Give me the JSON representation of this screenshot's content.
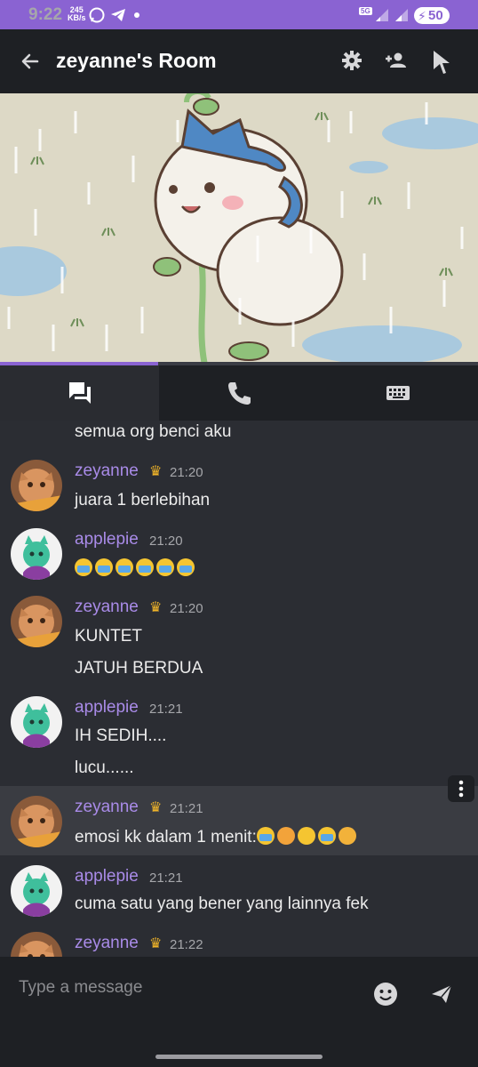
{
  "status": {
    "time": "9:22",
    "speed_value": "245",
    "speed_unit": "KB/s",
    "network": "5G",
    "battery": "50"
  },
  "appbar": {
    "title": "zeyanne's Room"
  },
  "video": {
    "progress_fraction": 0.33
  },
  "tabs": [
    {
      "name": "chat"
    },
    {
      "name": "voice"
    },
    {
      "name": "keyboard"
    }
  ],
  "messages": {
    "m0": {
      "text": "semua org benci aku"
    },
    "m1": {
      "author": "zeyanne",
      "time": "21:20",
      "lines": [
        "juara 1 berlebihan"
      ]
    },
    "m2": {
      "author": "applepie",
      "time": "21:20"
    },
    "m3": {
      "author": "zeyanne",
      "time": "21:20",
      "lines": [
        "KUNTET",
        "JATUH BERDUA"
      ]
    },
    "m4": {
      "author": "applepie",
      "time": "21:21",
      "lines": [
        "IH SEDIH....",
        "lucu......"
      ]
    },
    "m5": {
      "author": "zeyanne",
      "time": "21:21",
      "text": "emosi kk dalam 1 menit:"
    },
    "m6": {
      "author": "applepie",
      "time": "21:21",
      "lines": [
        "cuma satu yang bener yang lainnya fek"
      ]
    },
    "m7": {
      "author": "zeyanne",
      "time": "21:22"
    }
  },
  "composer": {
    "placeholder": "Type a message"
  },
  "colors": {
    "accent": "#8a63d2",
    "author": "#a98be8",
    "chat_bg": "#2b2d33",
    "bar_bg": "#1e2024"
  }
}
